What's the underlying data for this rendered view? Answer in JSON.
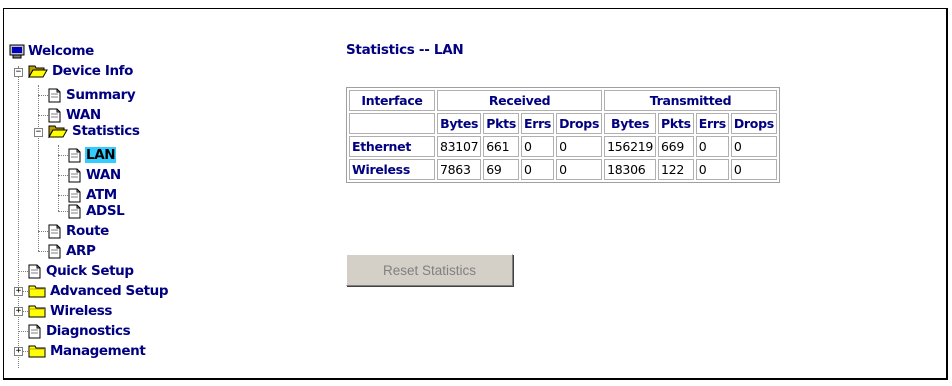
{
  "sidebar": {
    "welcome": "Welcome",
    "device_info": "Device Info",
    "summary": "Summary",
    "wan": "WAN",
    "statistics": "Statistics",
    "stats_lan": "LAN",
    "stats_wan": "WAN",
    "stats_atm": "ATM",
    "stats_adsl": "ADSL",
    "route": "Route",
    "arp": "ARP",
    "quick_setup": "Quick Setup",
    "advanced_setup": "Advanced Setup",
    "wireless": "Wireless",
    "diagnostics": "Diagnostics",
    "management": "Management",
    "expand_sign": "+",
    "collapse_sign": "−"
  },
  "main": {
    "title": "Statistics -- LAN",
    "table": {
      "col_interface": "Interface",
      "group_received": "Received",
      "group_transmitted": "Transmitted",
      "sub_headers": [
        "Bytes",
        "Pkts",
        "Errs",
        "Drops",
        "Bytes",
        "Pkts",
        "Errs",
        "Drops"
      ],
      "rows": [
        {
          "interface": "Ethernet",
          "values": [
            "83107",
            "661",
            "0",
            "0",
            "156219",
            "669",
            "0",
            "0"
          ]
        },
        {
          "interface": "Wireless",
          "values": [
            "7863",
            "69",
            "0",
            "0",
            "18306",
            "122",
            "0",
            "0"
          ]
        }
      ]
    },
    "reset_button": "Reset Statistics"
  },
  "colors": {
    "link": "#000080",
    "selected": "#33ccff",
    "folder": "#ffff00"
  }
}
